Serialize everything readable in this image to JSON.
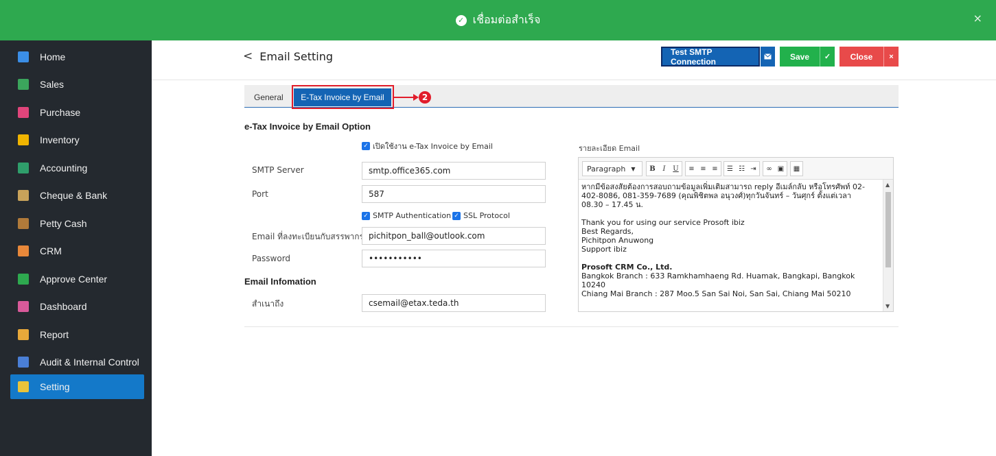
{
  "banner": {
    "icon": "check-circle-icon",
    "text": "เชื่อมต่อสำเร็จ",
    "close": "×",
    "color": "#2ea94f"
  },
  "sidebar": {
    "items": [
      {
        "label": "Home",
        "icon": "home-icon",
        "color": "#3b8ee6"
      },
      {
        "label": "Sales",
        "icon": "sales-icon",
        "color": "#3ba55c"
      },
      {
        "label": "Purchase",
        "icon": "cart-icon",
        "color": "#e0457b"
      },
      {
        "label": "Inventory",
        "icon": "box-icon",
        "color": "#f0b400"
      },
      {
        "label": "Accounting",
        "icon": "book-icon",
        "color": "#2f9e6b"
      },
      {
        "label": "Cheque & Bank",
        "icon": "bank-icon",
        "color": "#c8a25a"
      },
      {
        "label": "Petty Cash",
        "icon": "wallet-icon",
        "color": "#b07a3a"
      },
      {
        "label": "CRM",
        "icon": "crm-icon",
        "color": "#e8883a"
      },
      {
        "label": "Approve Center",
        "icon": "approve-icon",
        "color": "#2ea94f"
      },
      {
        "label": "Dashboard",
        "icon": "pie-chart-icon",
        "color": "#d95a9a"
      },
      {
        "label": "Report",
        "icon": "report-icon",
        "color": "#e8a83a"
      },
      {
        "label": "Audit & Internal Control",
        "icon": "audit-icon",
        "color": "#4a7fd6"
      },
      {
        "label": "Setting",
        "icon": "tools-icon",
        "color": "#e8c33a"
      }
    ],
    "active_color": "#1479c9"
  },
  "header": {
    "back": "<",
    "title": "Email Setting",
    "test_label": "Test SMTP Connection",
    "save_label": "Save",
    "close_label": "Close",
    "close_glyph": "×"
  },
  "tabs": {
    "general": "General",
    "etax": "E-Tax Invoice by Email",
    "step": "2"
  },
  "form": {
    "section_title": "e-Tax Invoice by Email Option",
    "enable_label": "เปิดใช้งาน e-Tax Invoice by Email",
    "smtp_server_label": "SMTP Server",
    "smtp_server_value": "smtp.office365.com",
    "port_label": "Port",
    "port_value": "587",
    "smtp_auth_label": "SMTP Authentication",
    "ssl_label": "SSL Protocol",
    "email_label": "Email ที่ลงทะเบียนกับสรรพากร",
    "email_value": "pichitpon_ball@outlook.com",
    "password_label": "Password",
    "password_value": "•••••••••••"
  },
  "info": {
    "section_title": "Email Infomation",
    "cc_label": "สำเนาถึง",
    "cc_value": "csemail@etax.teda.th"
  },
  "editor": {
    "label": "รายละเอียด Email",
    "format": "Paragraph",
    "lines": [
      "หากมีข้อสงสัยต้องการสอบถามข้อมูลเพิ่มเติมสามารถ reply อีเมล์กลับ หรือโทรศัพท์ 02-",
      "402-8086, 081-359-7689 (คุณพิชิตพล อนุวงศ์)ทุกวันจันทร์ – วันศุกร์ ตั้งแต่เวลา",
      "08.30 – 17.45 น.",
      "",
      "Thank you for using our service Prosoft ibiz",
      "Best Regards,",
      "Pichitpon Anuwong",
      "Support ibiz",
      ""
    ],
    "company": "Prosoft CRM Co., Ltd.",
    "branch_lines": [
      "Bangkok Branch : 633 Ramkhamhaeng Rd. Huamak, Bangkapi, Bangkok 10240",
      "Chiang Mai Branch : 287 Moo.5 San Sai Noi, San Sai, Chiang Mai 50210"
    ]
  }
}
